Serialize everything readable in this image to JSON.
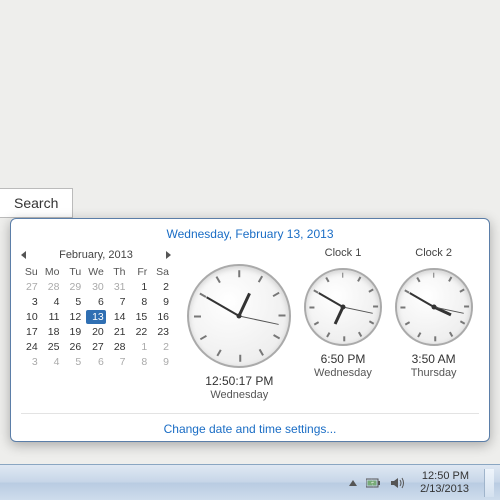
{
  "searchTab": {
    "label": "Search"
  },
  "popup": {
    "fullDate": "Wednesday, February 13, 2013",
    "settingsLink": "Change date and time settings..."
  },
  "calendar": {
    "monthLabel": "February, 2013",
    "dow": [
      "Su",
      "Mo",
      "Tu",
      "We",
      "Th",
      "Fr",
      "Sa"
    ],
    "days": [
      {
        "n": 27,
        "dim": true
      },
      {
        "n": 28,
        "dim": true
      },
      {
        "n": 29,
        "dim": true
      },
      {
        "n": 30,
        "dim": true
      },
      {
        "n": 31,
        "dim": true
      },
      {
        "n": 1
      },
      {
        "n": 2
      },
      {
        "n": 3
      },
      {
        "n": 4
      },
      {
        "n": 5
      },
      {
        "n": 6
      },
      {
        "n": 7
      },
      {
        "n": 8
      },
      {
        "n": 9
      },
      {
        "n": 10
      },
      {
        "n": 11
      },
      {
        "n": 12
      },
      {
        "n": 13,
        "sel": true
      },
      {
        "n": 14
      },
      {
        "n": 15
      },
      {
        "n": 16
      },
      {
        "n": 17
      },
      {
        "n": 18
      },
      {
        "n": 19
      },
      {
        "n": 20
      },
      {
        "n": 21
      },
      {
        "n": 22
      },
      {
        "n": 23
      },
      {
        "n": 24
      },
      {
        "n": 25
      },
      {
        "n": 26
      },
      {
        "n": 27
      },
      {
        "n": 28
      },
      {
        "n": 1,
        "dim": true
      },
      {
        "n": 2,
        "dim": true
      },
      {
        "n": 3,
        "dim": true
      },
      {
        "n": 4,
        "dim": true
      },
      {
        "n": 5,
        "dim": true
      },
      {
        "n": 6,
        "dim": true
      },
      {
        "n": 7,
        "dim": true
      },
      {
        "n": 8,
        "dim": true
      },
      {
        "n": 9,
        "dim": true
      }
    ]
  },
  "clocks": [
    {
      "label": "",
      "size": "big",
      "time": "12:50:17 PM",
      "day": "Wednesday",
      "h": 12,
      "m": 50,
      "s": 17
    },
    {
      "label": "Clock 1",
      "size": "small",
      "time": "6:50 PM",
      "day": "Wednesday",
      "h": 6,
      "m": 50,
      "s": 17
    },
    {
      "label": "Clock 2",
      "size": "small",
      "time": "3:50 AM",
      "day": "Thursday",
      "h": 3,
      "m": 50,
      "s": 17
    }
  ],
  "taskbar": {
    "time": "12:50 PM",
    "date": "2/13/2013"
  }
}
